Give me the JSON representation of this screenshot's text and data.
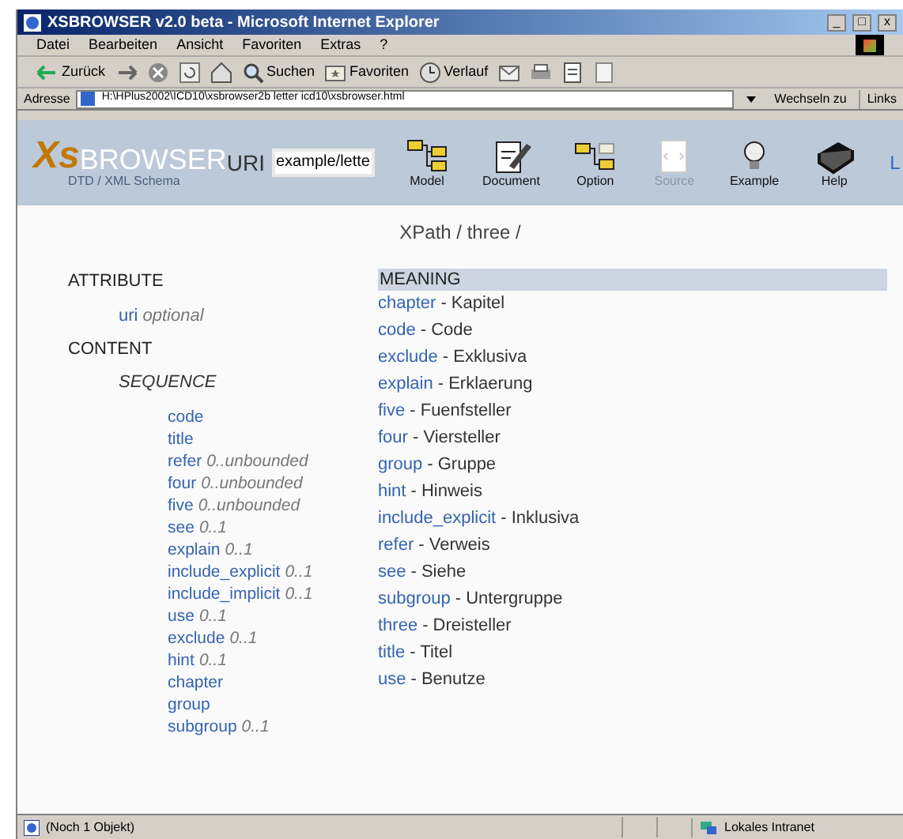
{
  "window": {
    "title": "XSBROWSER v2.0 beta - Microsoft Internet Explorer",
    "controls": [
      "_",
      "□",
      "x"
    ]
  },
  "menu": [
    "Datei",
    "Bearbeiten",
    "Ansicht",
    "Favoriten",
    "Extras",
    "?"
  ],
  "toolbar": [
    {
      "kind": "back",
      "label": "Zurück"
    },
    {
      "kind": "forward"
    },
    {
      "kind": "stop"
    },
    {
      "kind": "refresh"
    },
    {
      "kind": "home"
    },
    {
      "kind": "search",
      "label": "Suchen"
    },
    {
      "kind": "favorites",
      "label": "Favoriten"
    },
    {
      "kind": "history",
      "label": "Verlauf"
    },
    {
      "kind": "mail"
    },
    {
      "kind": "print"
    },
    {
      "kind": "edit"
    },
    {
      "kind": "discuss"
    }
  ],
  "address": {
    "label": "Adresse",
    "value": "H:\\HPlus2002\\ICD10\\xsbrowser2b letter icd10\\xsbrowser.html",
    "go": "Wechseln zu",
    "links": "Links"
  },
  "app": {
    "logo_xs": "Xs",
    "logo_browser": "BROWSER",
    "logo_sub": "DTD / XML Schema",
    "uri_label": "URI",
    "uri_value": "example/lette",
    "tools": [
      {
        "kind": "model",
        "label": "Model",
        "disabled": false
      },
      {
        "kind": "document",
        "label": "Document",
        "disabled": false
      },
      {
        "kind": "option",
        "label": "Option",
        "disabled": false
      },
      {
        "kind": "source",
        "label": "Source",
        "disabled": true
      },
      {
        "kind": "example",
        "label": "Example",
        "disabled": false
      },
      {
        "kind": "help",
        "label": "Help",
        "disabled": false
      }
    ],
    "cut_link": "L"
  },
  "xpath": "XPath / three /",
  "structure": {
    "attribute_heading": "ATTRIBUTE",
    "attributes": [
      {
        "name": "uri",
        "occurs": "optional"
      }
    ],
    "content_heading": "CONTENT",
    "sequence_heading": "SEQUENCE",
    "elements": [
      {
        "name": "code"
      },
      {
        "name": "title"
      },
      {
        "name": "refer",
        "occurs": "0..unbounded"
      },
      {
        "name": "four",
        "occurs": "0..unbounded"
      },
      {
        "name": "five",
        "occurs": "0..unbounded"
      },
      {
        "name": "see",
        "occurs": "0..1"
      },
      {
        "name": "explain",
        "occurs": "0..1"
      },
      {
        "name": "include_explicit",
        "occurs": "0..1"
      },
      {
        "name": "include_implicit",
        "occurs": "0..1"
      },
      {
        "name": "use",
        "occurs": "0..1"
      },
      {
        "name": "exclude",
        "occurs": "0..1"
      },
      {
        "name": "hint",
        "occurs": "0..1"
      },
      {
        "name": "chapter"
      },
      {
        "name": "group"
      },
      {
        "name": "subgroup",
        "occurs": "0..1"
      }
    ]
  },
  "meaning": {
    "heading": "MEANING",
    "rows": [
      {
        "name": "chapter",
        "text": "- Kapitel"
      },
      {
        "name": "code",
        "text": "- Code"
      },
      {
        "name": "exclude",
        "text": "- Exklusiva"
      },
      {
        "name": "explain",
        "text": "- Erklaerung"
      },
      {
        "name": "five",
        "text": "- Fuenfsteller"
      },
      {
        "name": "four",
        "text": "- Viersteller"
      },
      {
        "name": "group",
        "text": "- Gruppe"
      },
      {
        "name": "hint",
        "text": "- Hinweis"
      },
      {
        "name": "include_explicit",
        "text": "- Inklusiva"
      },
      {
        "name": "refer",
        "text": "- Verweis"
      },
      {
        "name": "see",
        "text": "- Siehe"
      },
      {
        "name": "subgroup",
        "text": "- Untergruppe"
      },
      {
        "name": "three",
        "text": "- Dreisteller"
      },
      {
        "name": "title",
        "text": "- Titel"
      },
      {
        "name": "use",
        "text": "- Benutze"
      }
    ]
  },
  "status_bar": {
    "text": "(Noch 1 Objekt)",
    "zone": "Lokales Intranet"
  }
}
